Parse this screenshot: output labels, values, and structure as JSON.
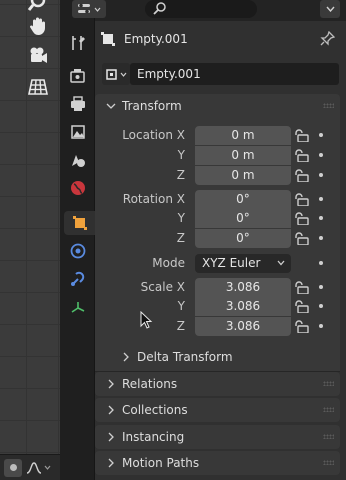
{
  "header": {
    "search_placeholder": ""
  },
  "object": {
    "name": "Empty.001",
    "data_name": "Empty.001"
  },
  "transform": {
    "title": "Transform",
    "location": {
      "x_label": "Location X",
      "y_label": "Y",
      "z_label": "Z",
      "x": "0 m",
      "y": "0 m",
      "z": "0 m"
    },
    "rotation": {
      "x_label": "Rotation X",
      "y_label": "Y",
      "z_label": "Z",
      "x": "0°",
      "y": "0°",
      "z": "0°"
    },
    "mode": {
      "label": "Mode",
      "value": "XYZ Euler"
    },
    "scale": {
      "x_label": "Scale X",
      "y_label": "Y",
      "z_label": "Z",
      "x": "3.086",
      "y": "3.086",
      "z": "3.086"
    }
  },
  "delta_transform": {
    "title": "Delta Transform"
  },
  "panels": {
    "relations": "Relations",
    "collections": "Collections",
    "instancing": "Instancing",
    "motion_paths": "Motion Paths"
  },
  "colors": {
    "accent_orange": "#f0a23c",
    "panel_bg": "#303030",
    "field_bg": "#545454"
  }
}
